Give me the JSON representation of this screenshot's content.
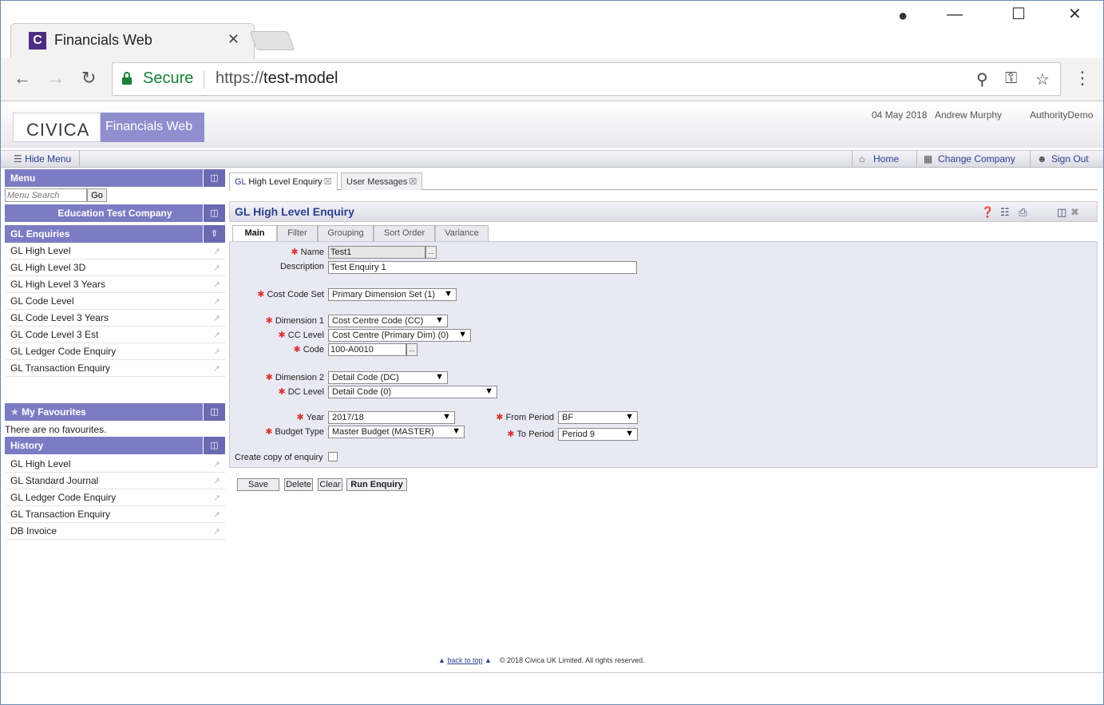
{
  "browser": {
    "tab_title": "Financials Web",
    "tab_close": "✕",
    "secure_label": "Secure",
    "url_scheme": "https://",
    "url_host": "test-model"
  },
  "header": {
    "logo": "CIVICA",
    "product": "Financials Web",
    "date": "04 May 2018",
    "user": "Andrew Murphy",
    "authority": "AuthorityDemo"
  },
  "navbar": {
    "hide_menu": "Hide Menu",
    "home": "Home",
    "change_company": "Change Company",
    "sign_out": "Sign Out"
  },
  "sidebar": {
    "menu_title": "Menu",
    "search_placeholder": "Menu Search",
    "go_label": "Go",
    "company": "Education Test Company",
    "section_title": "GL Enquiries",
    "items": [
      "GL High Level",
      "GL High Level 3D",
      "GL High Level 3 Years",
      "GL Code Level",
      "GL Code Level 3 Years",
      "GL Code Level 3 Est",
      "GL Ledger Code Enquiry",
      "GL Transaction Enquiry"
    ],
    "favourites_title": "My Favourites",
    "favourites_empty": "There are no favourites.",
    "history_title": "History",
    "history": [
      "GL High Level",
      "GL Standard Journal",
      "GL Ledger Code Enquiry",
      "GL Transaction Enquiry",
      "DB Invoice"
    ]
  },
  "page_tabs": {
    "active_prefix": "GL",
    "active_rest": " High Level Enquiry",
    "second": "User Messages"
  },
  "panel": {
    "title": "GL High Level Enquiry"
  },
  "subtabs": [
    "Main",
    "Filter",
    "Grouping",
    "Sort Order",
    "Variance"
  ],
  "form": {
    "name_label": "Name",
    "name_value": "Test1",
    "description_label": "Description",
    "description_value": "Test Enquiry 1",
    "cost_code_set_label": "Cost Code Set",
    "cost_code_set_value": "Primary Dimension Set (1)",
    "dimension1_label": "Dimension 1",
    "dimension1_value": "Cost Centre Code (CC)",
    "cc_level_label": "CC Level",
    "cc_level_value": "Cost Centre (Primary Dim) (0)",
    "code_label": "Code",
    "code_value": "100-A0010",
    "dimension2_label": "Dimension 2",
    "dimension2_value": "Detail Code (DC)",
    "dc_level_label": "DC Level",
    "dc_level_value": "Detail Code (0)",
    "year_label": "Year",
    "year_value": "2017/18",
    "budget_type_label": "Budget Type",
    "budget_type_value": "Master Budget (MASTER)",
    "from_period_label": "From Period",
    "from_period_value": "BF",
    "to_period_label": "To Period",
    "to_period_value": "Period 9",
    "create_copy_label": "Create copy of enquiry",
    "dots": "..."
  },
  "buttons": {
    "save": "Save",
    "delete": "Delete",
    "clear": "Clear",
    "run": "Run Enquiry"
  },
  "footer": {
    "back_to_top": "back to top",
    "copyright": "© 2018 Civica UK Limited. All rights reserved."
  }
}
